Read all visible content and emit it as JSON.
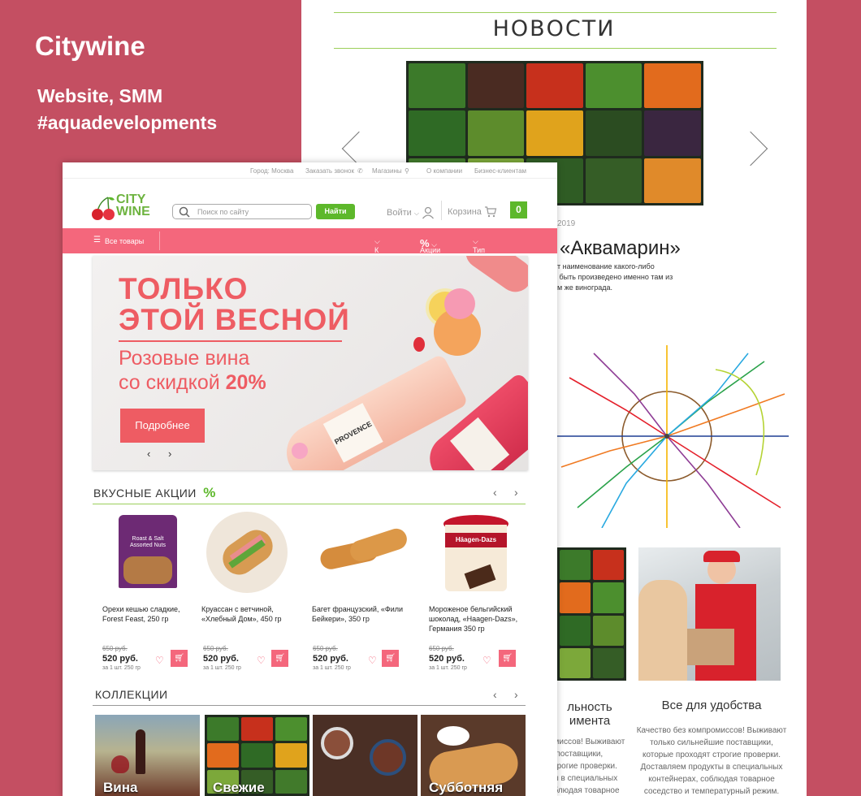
{
  "brand": {
    "title": "Citywine",
    "services": "Website, SMM",
    "tag": "#aquadevelopments"
  },
  "colors": {
    "background": "#c44f62",
    "nav_pink": "#f4677c",
    "green": "#5db82b",
    "banner_red": "#ee5c63"
  },
  "news_page": {
    "title": "НОВОСТИ",
    "date": "2019",
    "heading": "«Аквамарин»",
    "paragraph": [
      "ит наименование какого-либо",
      "о быть произведено именно там из",
      "ом же винограда."
    ],
    "card_left_title": [
      "льность",
      "имента"
    ],
    "card_left_text": [
      "омиссов! Выживают",
      "е поставщики,",
      "строгие проверки.",
      "ты в специальных",
      "облюдая товарное"
    ],
    "card_right_title": "Все для удобства",
    "card_right_text": [
      "Качество без компромиссов! Выживают",
      "только сильнейшие поставщики,",
      "которые проходят строгие проверки.",
      "Доставляем продукты в специальных",
      "контейнерах, соблюдая товарное",
      "соседство и температурный режим."
    ]
  },
  "shop": {
    "topbar": {
      "city": "Город: Москва",
      "callback": "Заказать звонок",
      "stores": "Магазины",
      "about": "О компании",
      "business": "Бизнес-клиентам"
    },
    "logo": {
      "line1": "CITY",
      "line2": "WINE"
    },
    "search": {
      "placeholder": "Поиск по сайту",
      "button": "Найти"
    },
    "login": "Войти",
    "cart": {
      "label": "Корзина",
      "count": "0"
    },
    "nav": {
      "all": "Все товары",
      "post": "К Посту",
      "sales": "Акции",
      "sales_icon": "%",
      "diet": "Тип питания"
    },
    "banner": {
      "line1": "ТОЛЬКО",
      "line2": "ЭТОЙ ВЕСНОЙ",
      "line3": "Розовые вина",
      "line4_prefix": "со скидкой ",
      "line4_discount": "20%",
      "button": "Подробнее",
      "bottle_label": "PROVENCE"
    },
    "promos": {
      "title": "ВКУСНЫЕ АКЦИИ",
      "icon": "%",
      "products": [
        {
          "name": "Орехи кешью сладкие, Forest Feast, 250 гр",
          "old_price": "650 руб.",
          "price": "520 руб.",
          "unit": "за 1 шт. 250 гр",
          "pack_text1": "Roast & Salt",
          "pack_text2": "Assorted Nuts"
        },
        {
          "name": "Круассан с ветчиной, «Хлебный Дом», 450 гр",
          "old_price": "650 руб.",
          "price": "520 руб.",
          "unit": "за 1 шт. 250 гр"
        },
        {
          "name": "Багет французский, «Фили Бейкери», 350 гр",
          "old_price": "650 руб.",
          "price": "520 руб.",
          "unit": "за 1 шт. 250 гр"
        },
        {
          "name": "Мороженое бельгийский шоколад, «Haagen-Dazs», Германия 350 гр",
          "old_price": "650 руб.",
          "price": "520 руб.",
          "unit": "за 1 шт. 250 гр",
          "pack_text": "Häagen-Dazs"
        }
      ]
    },
    "collections": {
      "title": "КОЛЛЕКЦИИ",
      "items": [
        "Вина",
        "Свежие",
        "",
        "Субботняя"
      ]
    }
  }
}
